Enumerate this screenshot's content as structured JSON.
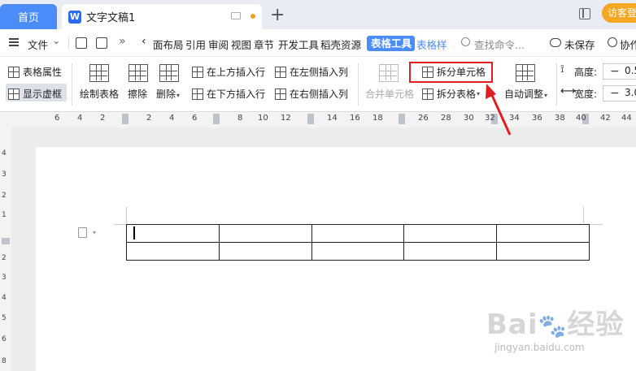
{
  "tabbar": {
    "home_label": "首页",
    "doc_logo": "W",
    "doc_title": "文字文稿1",
    "new_tab": "+",
    "login_label": "访客登"
  },
  "menubar": {
    "file_label": "文件",
    "file_caret": "⌄",
    "more": "»",
    "scroll_left": "‹",
    "items": [
      "面布局",
      "引用",
      "审阅",
      "视图",
      "章节",
      "开发工具",
      "稻壳资源"
    ],
    "active_tab": "表格工具",
    "next_tab": "表格样",
    "search_placeholder": "查找命令...",
    "unsaved_label": "未保存",
    "collab_label": "协作"
  },
  "ribbon": {
    "table_props": "表格属性",
    "show_gridlines": "显示虚框",
    "draw_table": "绘制表格",
    "erase": "擦除",
    "delete": "删除",
    "insert_row_above": "在上方插入行",
    "insert_row_below": "在下方插入行",
    "insert_col_left": "在左侧插入列",
    "insert_col_right": "在右侧插入列",
    "merge_cells": "合并单元格",
    "split_cells": "拆分单元格",
    "split_table": "拆分表格",
    "auto_fit": "自动调整",
    "height_label": "高度:",
    "width_label": "宽度:",
    "minus": "−",
    "height_value": "0.5",
    "width_value": "3.0"
  },
  "ruler": {
    "ticks": [
      "6",
      "4",
      "2",
      "2",
      "4",
      "6",
      "8",
      "10",
      "12",
      "14",
      "16",
      "18",
      "20",
      "22",
      "24",
      "26",
      "28",
      "30",
      "32",
      "34",
      "36",
      "38",
      "40",
      "42",
      "44"
    ],
    "vticks": [
      "4",
      "3",
      "2",
      "1",
      "1",
      "2",
      "3",
      "4",
      "5",
      "6",
      "7",
      "8"
    ]
  },
  "watermark": "jingyan.baidu.com",
  "colors": {
    "accent": "#4b8df8",
    "highlight_red": "#e02020",
    "login_orange": "#f5a623"
  }
}
